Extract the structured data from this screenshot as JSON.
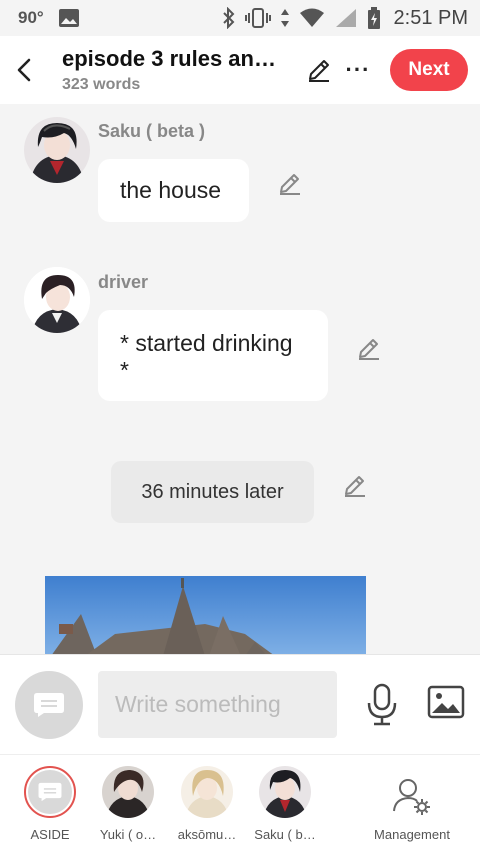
{
  "status_bar": {
    "left_indicator": "90°",
    "time": "2:51 PM",
    "icons": [
      "image-icon",
      "bluetooth-icon",
      "vibrate-icon",
      "data-arrows-icon",
      "wifi-icon",
      "signal-icon",
      "battery-icon"
    ]
  },
  "header": {
    "title": "episode 3 rules an…",
    "word_count": "323 words",
    "next_label": "Next",
    "more_label": "···",
    "accent_color": "#f2434b"
  },
  "messages": [
    {
      "speaker": "Saku ( beta )",
      "text": "the house"
    },
    {
      "speaker": "driver",
      "text": "* started drinking *"
    }
  ],
  "narration": {
    "text": "36 minutes later"
  },
  "compose": {
    "placeholder": "Write something"
  },
  "characters": [
    {
      "label": "ASIDE"
    },
    {
      "label": "Yuki ( o…"
    },
    {
      "label": "aksōmu…"
    },
    {
      "label": "Saku ( b…"
    },
    {
      "label": "Management"
    }
  ]
}
